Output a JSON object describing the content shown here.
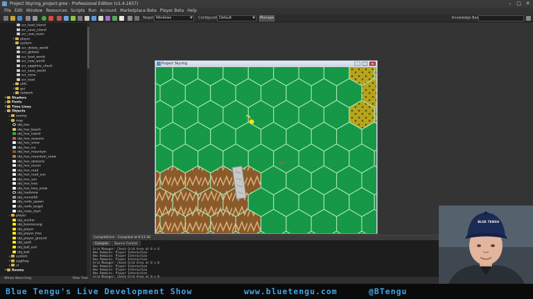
{
  "window": {
    "title": "Project Skyring_project.gmx  -  Professional Edition (v1.4.1657)",
    "controls": [
      "–",
      "□",
      "✕"
    ]
  },
  "menu": [
    "File",
    "Edit",
    "Window",
    "Resources",
    "Scripts",
    "Run",
    "Account",
    "Marketplace Beta",
    "Player Beta",
    "Help"
  ],
  "toolbar": {
    "target_label": "Target:",
    "target_value": "Windows",
    "configuration_label": "Configuration:",
    "configuration_value": "Default",
    "manage_label": "Manage",
    "knowledge_label": "Knowledge Base"
  },
  "tree": [
    {
      "text": "scr_load_island",
      "indent": 3,
      "icon": "script"
    },
    {
      "text": "scr_save_island",
      "indent": 3,
      "icon": "script"
    },
    {
      "text": "scr_new_room",
      "indent": 3,
      "icon": "script"
    },
    {
      "text": "player",
      "indent": 2,
      "icon": "folder",
      "exp": "+"
    },
    {
      "text": "system",
      "indent": 2,
      "icon": "folder",
      "exp": "–"
    },
    {
      "text": "scr_delete_world",
      "indent": 3,
      "icon": "script"
    },
    {
      "text": "scr_globals",
      "indent": 3,
      "icon": "script"
    },
    {
      "text": "scr_load_world",
      "indent": 3,
      "icon": "script"
    },
    {
      "text": "scr_new_world",
      "indent": 3,
      "icon": "script"
    },
    {
      "text": "scr_sapphire_check",
      "indent": 3,
      "icon": "script"
    },
    {
      "text": "scr_save_world",
      "indent": 3,
      "icon": "script"
    },
    {
      "text": "scr_none",
      "indent": 3,
      "icon": "script"
    },
    {
      "text": "scr_load",
      "indent": 3,
      "icon": "script"
    },
    {
      "text": "utils",
      "indent": 2,
      "icon": "folder",
      "exp": "+"
    },
    {
      "text": "gui",
      "indent": 2,
      "icon": "folder",
      "exp": "+"
    },
    {
      "text": "network",
      "indent": 2,
      "icon": "folder",
      "exp": "+"
    },
    {
      "text": "Shaders",
      "indent": 0,
      "icon": "folder",
      "exp": "+",
      "bold": true
    },
    {
      "text": "Fonts",
      "indent": 0,
      "icon": "folder",
      "exp": "+",
      "bold": true
    },
    {
      "text": "Time Lines",
      "indent": 0,
      "icon": "folder",
      "exp": "+",
      "bold": true
    },
    {
      "text": "Objects",
      "indent": 0,
      "icon": "folder",
      "exp": "–",
      "bold": true
    },
    {
      "text": "enemy",
      "indent": 1,
      "icon": "folder",
      "exp": "+"
    },
    {
      "text": "map",
      "indent": 1,
      "icon": "folder",
      "exp": "–"
    },
    {
      "text": "obj_hex",
      "indent": 2,
      "icon": "hex-outline"
    },
    {
      "text": "obj_hex_beach",
      "indent": 2,
      "icon": "beach"
    },
    {
      "text": "obj_hex_island",
      "indent": 2,
      "icon": "green"
    },
    {
      "text": "obj_hex_seasons",
      "indent": 2,
      "icon": "red"
    },
    {
      "text": "obj_hex_snow",
      "indent": 2,
      "icon": "white"
    },
    {
      "text": "obj_hex_ice",
      "indent": 2,
      "icon": "ice"
    },
    {
      "text": "obj_hex_mountain",
      "indent": 2,
      "icon": "brown"
    },
    {
      "text": "obj_hex_mountain_snow",
      "indent": 2,
      "icon": "brownwhite"
    },
    {
      "text": "obj_hex_obstacle",
      "indent": 2,
      "icon": "white"
    },
    {
      "text": "obj_hex_ocean",
      "indent": 2,
      "icon": "white"
    },
    {
      "text": "obj_hex_reed",
      "indent": 2,
      "icon": "white"
    },
    {
      "text": "obj_hex_reed_sun",
      "indent": 2,
      "icon": "white"
    },
    {
      "text": "obj_hex_sun",
      "indent": 2,
      "icon": "white"
    },
    {
      "text": "obj_hex_tree",
      "indent": 2,
      "icon": "white"
    },
    {
      "text": "obj_hex_tree_snow",
      "indent": 2,
      "icon": "white"
    },
    {
      "text": "obj_loadview",
      "indent": 2,
      "icon": "hex-outline"
    },
    {
      "text": "obj_monolith",
      "indent": 2,
      "icon": "gray"
    },
    {
      "text": "obj_node_spawn",
      "indent": 2,
      "icon": "white"
    },
    {
      "text": "obj_node_target",
      "indent": 2,
      "icon": "white"
    },
    {
      "text": "obj_node_start",
      "indent": 2,
      "icon": "white"
    },
    {
      "text": "player",
      "indent": 1,
      "icon": "folder",
      "exp": "–"
    },
    {
      "text": "obj_anchor",
      "indent": 2,
      "icon": "yellow"
    },
    {
      "text": "obj_boomerang",
      "indent": 2,
      "icon": "yellow"
    },
    {
      "text": "obj_player",
      "indent": 2,
      "icon": "yellow"
    },
    {
      "text": "obj_player_free",
      "indent": 2,
      "icon": "yellow"
    },
    {
      "text": "obj_player_ground",
      "indent": 2,
      "icon": "yellow"
    },
    {
      "text": "obj_spell",
      "indent": 2,
      "icon": "yellow"
    },
    {
      "text": "obj_ball_evil",
      "indent": 2,
      "icon": "yellow"
    },
    {
      "text": "obj_ball",
      "indent": 2,
      "icon": "yellow"
    },
    {
      "text": "system",
      "indent": 1,
      "icon": "folder",
      "exp": "+"
    },
    {
      "text": "sugthop",
      "indent": 1,
      "icon": "folder",
      "exp": "+"
    },
    {
      "text": "ui",
      "indent": 1,
      "icon": "folder",
      "exp": "+"
    },
    {
      "text": "Rooms",
      "indent": 0,
      "icon": "folder",
      "exp": "+",
      "bold": true
    }
  ],
  "tree_footer": {
    "left": "Whole Word Only",
    "right": "Filter Tree"
  },
  "game_window": {
    "title": "Project Skyring",
    "controls": [
      "–",
      "□",
      "✕"
    ]
  },
  "compile": {
    "title": "CompileForm - Compiled at 9:23:36",
    "tabs": [
      "Compile",
      "Source Control"
    ],
    "lines": [
      "Grid Manager: Check Grid Area at 0 x 0",
      "Hex Remains: Player Interaction",
      "Hex Remains: Player Interaction",
      "Hex Remains: Player Interaction",
      "Grid Manager: Check Grid Area at 0 x 0",
      "Hex Remains: Player Interaction",
      "Hex Remains: Player Interaction",
      "Hex Remains: Player Interaction",
      "Grid Manager: Check Grid Area at 0 x 0"
    ]
  },
  "webcam": {
    "cap_text": "BLUE TENGU"
  },
  "banner": {
    "left": "Blue Tengu's Live Development Show",
    "middle": "www.bluetengu.com",
    "right": "@BTengu"
  },
  "colors": {
    "banner_text": "#3fa6ea",
    "grass": "#169a48",
    "hex_line": "#a8e6b8",
    "dirt": "#8a5a2b",
    "sand": "#b6a51c",
    "selected_hex": "#f6b6b0",
    "player": "#f7e716"
  }
}
